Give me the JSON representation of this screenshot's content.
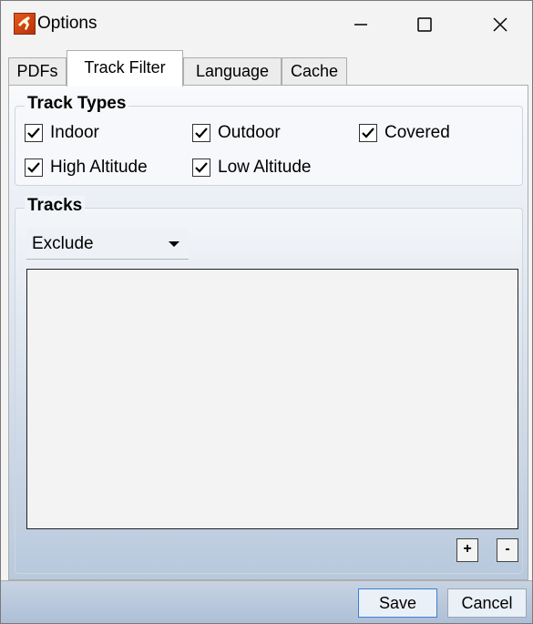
{
  "window": {
    "title": "Options",
    "app_icon": "runner-icon"
  },
  "titlebar_controls": {
    "minimize_icon": "minimize-icon",
    "maximize_icon": "maximize-icon",
    "close_icon": "close-icon"
  },
  "tabs": [
    {
      "label": "PDFs",
      "active": false
    },
    {
      "label": "Track Filter",
      "active": true
    },
    {
      "label": "Language",
      "active": false
    },
    {
      "label": "Cache",
      "active": false
    }
  ],
  "track_types": {
    "title": "Track Types",
    "options": [
      {
        "label": "Indoor",
        "checked": true
      },
      {
        "label": "Outdoor",
        "checked": true
      },
      {
        "label": "Covered",
        "checked": true
      },
      {
        "label": "High Altitude",
        "checked": true
      },
      {
        "label": "Low Altitude",
        "checked": true
      }
    ]
  },
  "tracks": {
    "title": "Tracks",
    "mode_selected": "Exclude",
    "add_label": "+",
    "remove_label": "-",
    "items": []
  },
  "footer": {
    "save_label": "Save",
    "cancel_label": "Cancel"
  },
  "colors": {
    "accent_border": "#3c7fd4",
    "panel_gradient_bottom": "#b9c9dd"
  }
}
